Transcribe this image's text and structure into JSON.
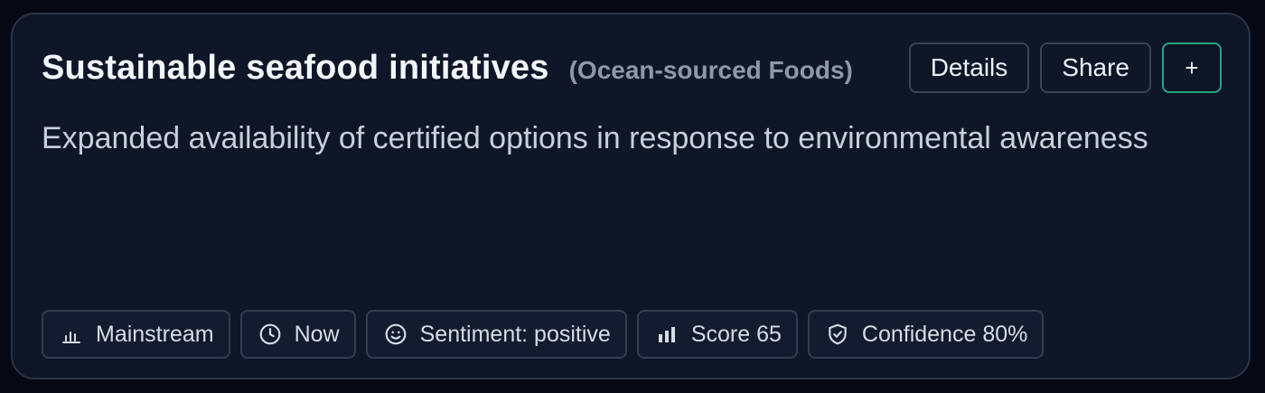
{
  "card": {
    "title": "Sustainable seafood initiatives",
    "category": "(Ocean-sourced Foods)",
    "description": "Expanded availability of certified options in response to environmental awareness"
  },
  "actions": {
    "details_label": "Details",
    "share_label": "Share",
    "add_label": "+"
  },
  "tags": [
    {
      "icon": "bar-chart-icon",
      "label": "Mainstream"
    },
    {
      "icon": "clock-icon",
      "label": "Now"
    },
    {
      "icon": "smile-icon",
      "label": "Sentiment: positive"
    },
    {
      "icon": "signal-bars-icon",
      "label": "Score 65"
    },
    {
      "icon": "shield-check-icon",
      "label": "Confidence 80%"
    }
  ],
  "colors": {
    "background": "#050914",
    "card": "#0e1628",
    "accent_border": "#2aa57f",
    "muted_text": "#8e98ab"
  }
}
